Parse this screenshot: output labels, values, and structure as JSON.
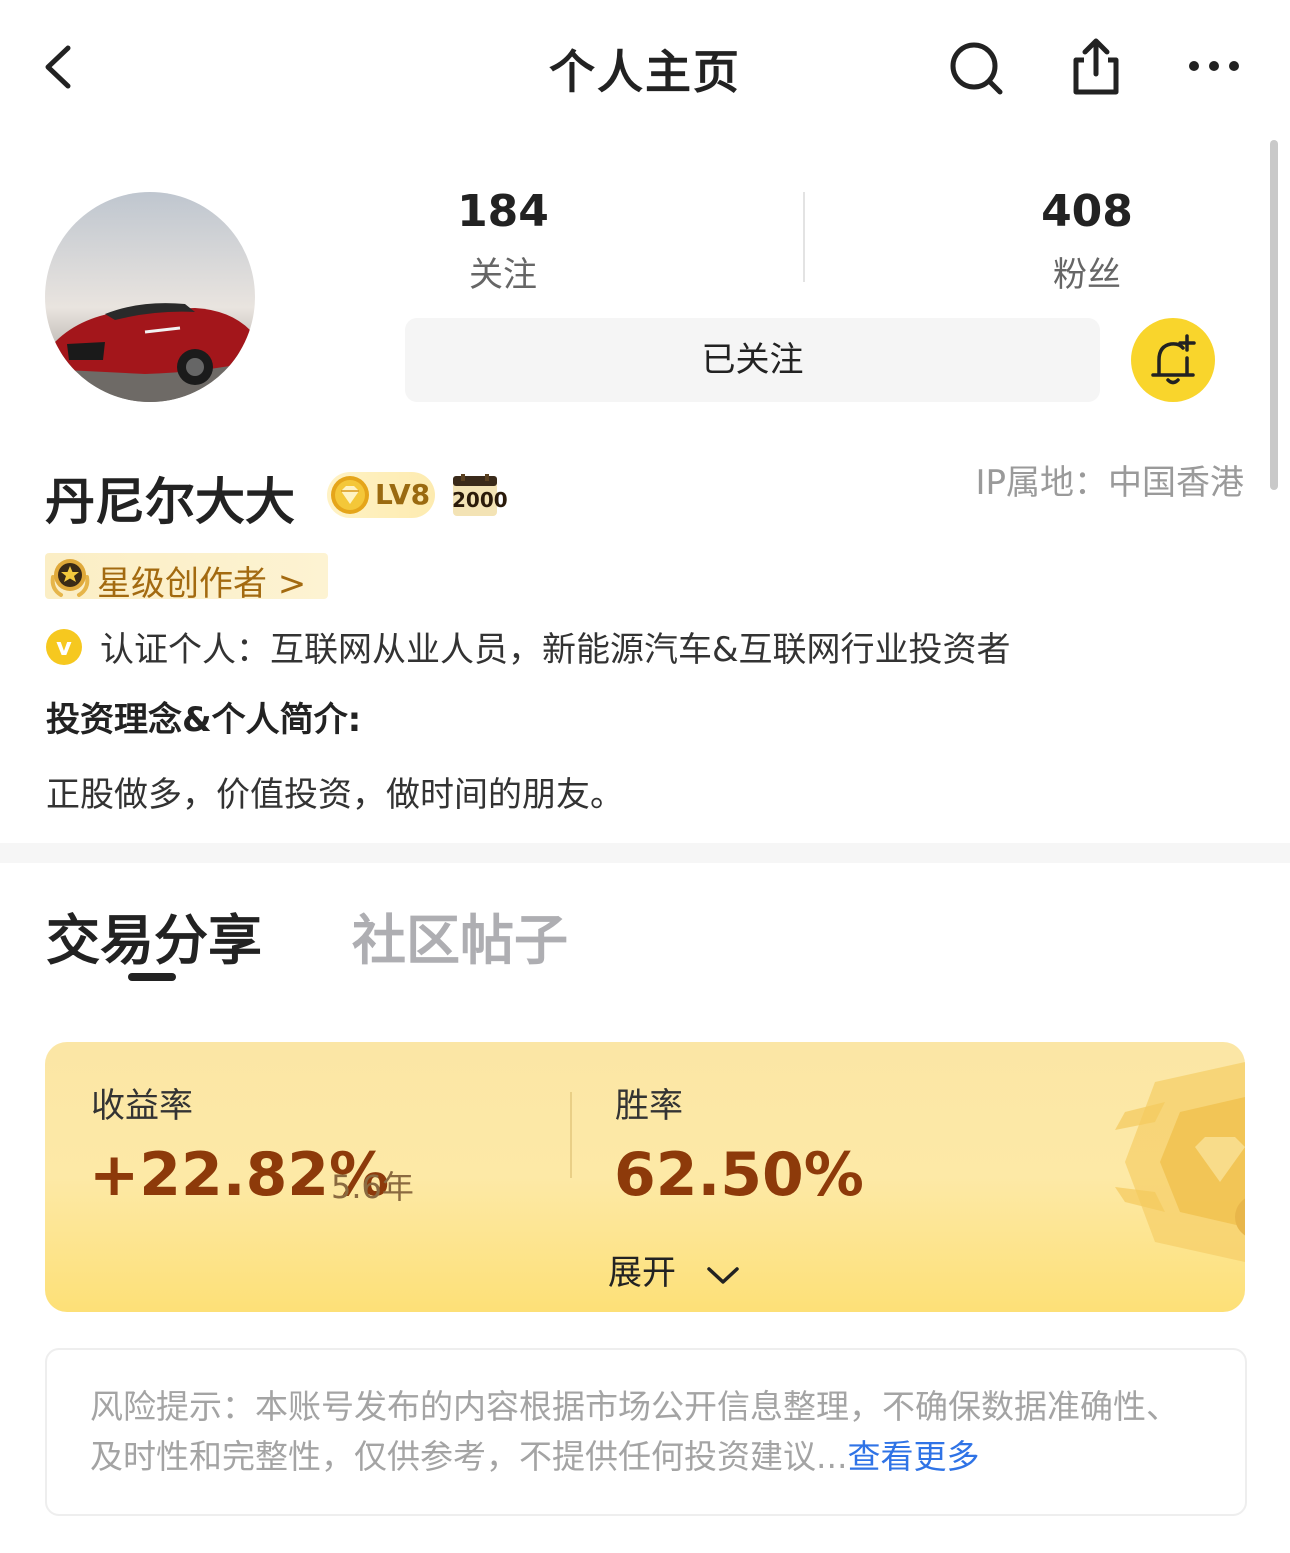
{
  "header": {
    "title": "个人主页",
    "icons": [
      "back-icon",
      "search-icon",
      "share-icon",
      "more-icon"
    ]
  },
  "profile": {
    "following_count": "184",
    "following_label": "关注",
    "followers_count": "408",
    "followers_label": "粉丝",
    "follow_button": "已关注",
    "name": "丹尼尔大大",
    "level": "LV8",
    "calendar_badge": "2000",
    "ip_location": "IP属地：中国香港",
    "creator_badge": "星级创作者 >",
    "verify_mark": "v",
    "verification": "认证个人：互联网从业人员，新能源汽车&互联网行业投资者",
    "bio_title": "投资理念&个人简介:",
    "bio": "正股做多，价值投资，做时间的朋友。"
  },
  "tabs": [
    {
      "label": "交易分享",
      "active": true
    },
    {
      "label": "社区帖子",
      "active": false
    }
  ],
  "performance": {
    "return_label": "收益率",
    "return_value": "+22.82%",
    "return_period": "5.6年",
    "winrate_label": "胜率",
    "winrate_value": "62.50%",
    "expand_label": "展开"
  },
  "risk": {
    "text": "风险提示：本账号发布的内容根据市场公开信息整理，不确保数据准确性、及时性和完整性，仅供参考，不提供任何投资建议...",
    "more": "查看更多"
  },
  "colors": {
    "accent_yellow": "#f9d52c",
    "return_color": "#8d3a0a",
    "link_blue": "#2f73e6",
    "creator_text": "#a36a10"
  }
}
